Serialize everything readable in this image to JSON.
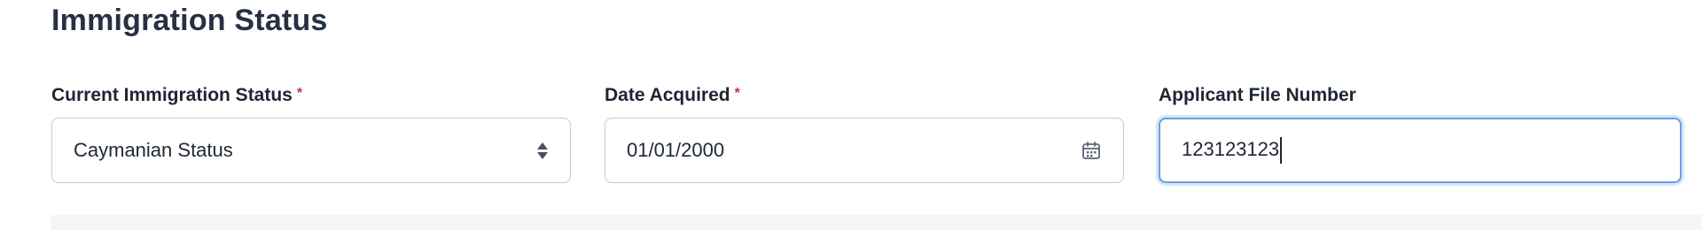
{
  "section": {
    "title": "Immigration Status"
  },
  "fields": {
    "immigration_status": {
      "label": "Current Immigration Status",
      "required_mark": "*",
      "value": "Caymanian Status",
      "icon": "select-arrows-icon"
    },
    "date_acquired": {
      "label": "Date Acquired",
      "required_mark": "*",
      "value": "01/01/2000",
      "icon": "calendar-icon"
    },
    "applicant_file_number": {
      "label": "Applicant File Number",
      "value": "123123123"
    }
  },
  "colors": {
    "required": "#c4314b",
    "focus_border": "#6f9fd8",
    "input_border": "#c7ccd4"
  }
}
